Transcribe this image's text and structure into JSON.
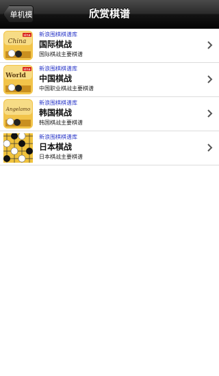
{
  "navbar": {
    "back_label": "单机模式",
    "title": "欣赏棋谱"
  },
  "items": [
    {
      "source": "新浪围棋棋谱库",
      "title": "国际棋战",
      "subtitle": "国际棋战主要棋谱",
      "thumb_text": "China",
      "thumb_badge": "sina"
    },
    {
      "source": "新浪围棋棋谱库",
      "title": "中国棋战",
      "subtitle": "中国职业棋战主要棋谱",
      "thumb_text": "World",
      "thumb_badge": "sina"
    },
    {
      "source": "新浪围棋棋谱库",
      "title": "韩国棋战",
      "subtitle": "韩国棋战主要棋谱",
      "thumb_text": "Angelamo",
      "thumb_badge": ""
    },
    {
      "source": "新浪围棋棋谱库",
      "title": "日本棋战",
      "subtitle": "日本棋战主要棋谱",
      "thumb_text": "",
      "thumb_badge": ""
    }
  ],
  "colors": {
    "source_text": "#2a37c8",
    "thumb_bg": "#f2c44a"
  }
}
